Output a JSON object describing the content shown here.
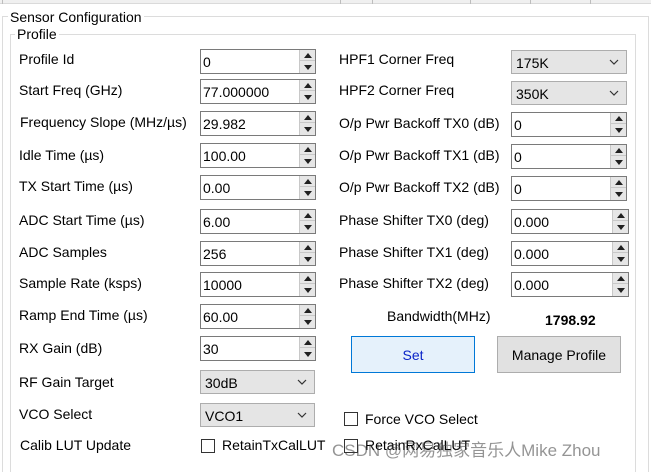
{
  "outer_title": "Sensor Configuration",
  "profile_group_title": "Profile",
  "left_fields": [
    {
      "label": "Profile Id",
      "value": "0"
    },
    {
      "label": "Start Freq (GHz)",
      "value": "77.000000"
    },
    {
      "label": "Frequency Slope (MHz/µs)",
      "value": "29.982"
    },
    {
      "label": "Idle Time (µs)",
      "value": "100.00"
    },
    {
      "label": "TX Start Time (µs)",
      "value": "0.00"
    },
    {
      "label": "ADC Start Time (µs)",
      "value": "6.00"
    },
    {
      "label": "ADC Samples",
      "value": "256"
    },
    {
      "label": "Sample Rate (ksps)",
      "value": "10000"
    },
    {
      "label": "Ramp End Time (µs)",
      "value": "60.00"
    },
    {
      "label": "RX Gain (dB)",
      "value": "30"
    }
  ],
  "rf_gain_target": {
    "label": "RF Gain Target",
    "value": "30dB"
  },
  "vco_select": {
    "label": "VCO Select",
    "value": "VCO1"
  },
  "calib_lut_update": {
    "label": "Calib LUT Update"
  },
  "retain_tx_cal_lut": {
    "label": "RetainTxCalLUT",
    "checked": false
  },
  "retain_rx_cal_lut": {
    "label": "RetainRxCalLUT",
    "checked": false
  },
  "hpf1": {
    "label": "HPF1 Corner Freq",
    "value": "175K"
  },
  "hpf2": {
    "label": "HPF2 Corner Freq",
    "value": "350K"
  },
  "right_fields": [
    {
      "label": "O/p Pwr Backoff TX0 (dB)",
      "value": "0"
    },
    {
      "label": "O/p Pwr Backoff TX1 (dB)",
      "value": "0"
    },
    {
      "label": "O/p Pwr Backoff TX2 (dB)",
      "value": "0"
    },
    {
      "label": "Phase Shifter TX0 (deg)",
      "value": "0.000"
    },
    {
      "label": "Phase Shifter TX1 (deg)",
      "value": "0.000"
    },
    {
      "label": "Phase Shifter TX2 (deg)",
      "value": "0.000"
    }
  ],
  "bandwidth": {
    "label": "Bandwidth(MHz)",
    "value": "1798.92"
  },
  "set_button": {
    "label": "Set"
  },
  "manage_profile_button": {
    "label": "Manage Profile"
  },
  "force_vco_select": {
    "label": "Force VCO Select",
    "checked": false
  },
  "watermark": "CSDN @网易独家音乐人Mike Zhou",
  "colors": {
    "set_button_text": "#0a24c8",
    "set_button_bg": "#e5f1fb",
    "set_button_border": "#0078d7"
  }
}
